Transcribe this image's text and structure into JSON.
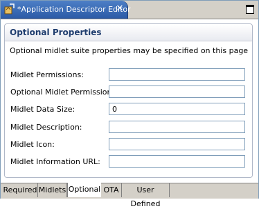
{
  "editor_tab": {
    "title": "*Application Descriptor Editor",
    "close_glyph": "✕"
  },
  "section": {
    "title": "Optional Properties",
    "description": "Optional midlet suite properties may be specified on this page"
  },
  "fields": [
    {
      "label": "Midlet Permissions:",
      "value": ""
    },
    {
      "label": "Optional Midlet Permissions:",
      "value": ""
    },
    {
      "label": "Midlet Data Size:",
      "value": "0"
    },
    {
      "label": "Midlet Description:",
      "value": ""
    },
    {
      "label": "Midlet Icon:",
      "value": ""
    },
    {
      "label": "Midlet Information URL:",
      "value": ""
    }
  ],
  "bottom_tabs": [
    {
      "label": "Required",
      "active": false
    },
    {
      "label": "Midlets",
      "active": false
    },
    {
      "label": "Optional",
      "active": true
    },
    {
      "label": "OTA",
      "active": false
    },
    {
      "label": "User Defined",
      "active": false
    }
  ],
  "colors": {
    "active_tab": "#2b5aa6",
    "input_border": "#7f9db9",
    "section_title": "#1f3d6e"
  }
}
